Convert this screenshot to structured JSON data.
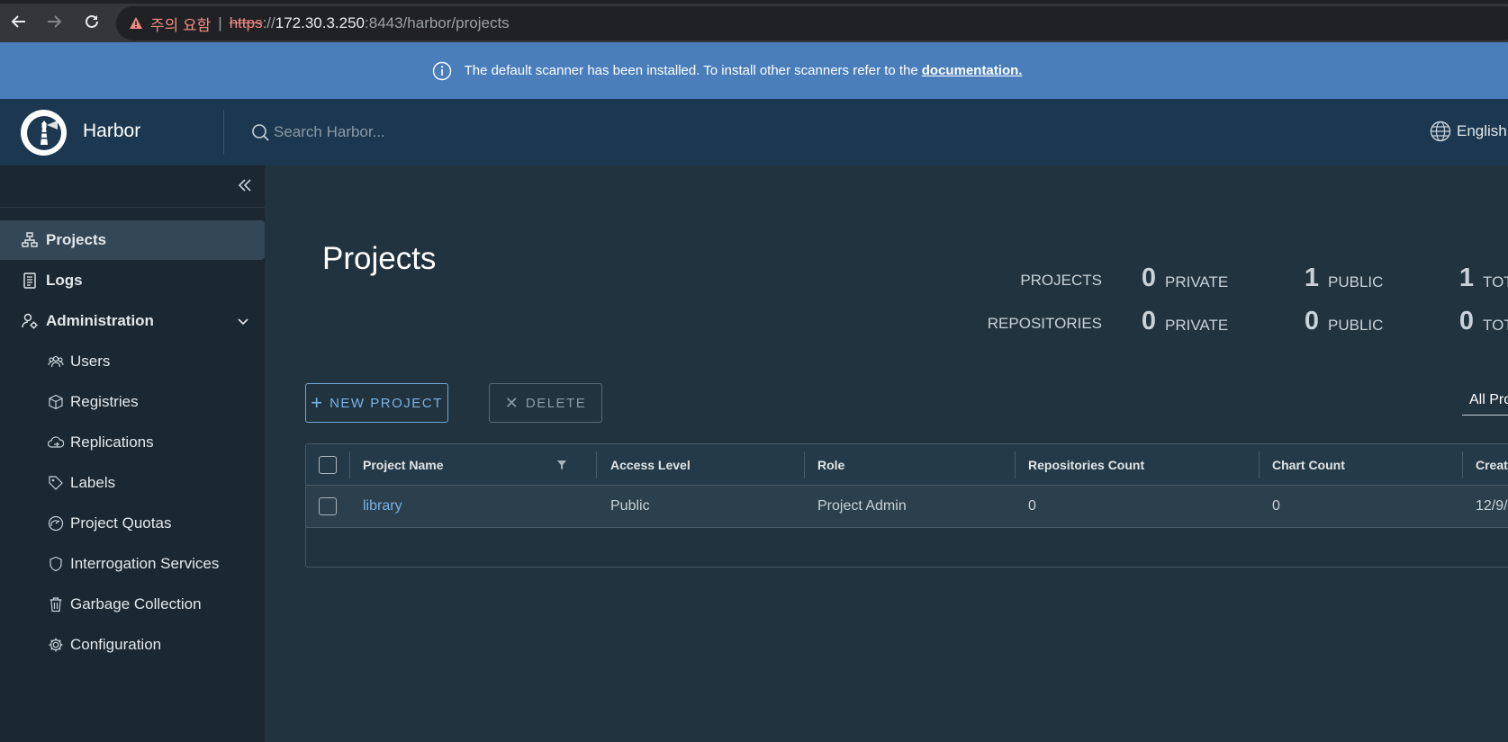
{
  "browser": {
    "warning_text": "주의 요함",
    "url_protocol": "https",
    "url_protocol_rest": "://",
    "url_host": "172.30.3.250",
    "url_path": ":8443/harbor/projects"
  },
  "banner": {
    "text": "The default scanner has been installed. To install other scanners refer to the",
    "link": "documentation."
  },
  "header": {
    "brand": "Harbor",
    "search_placeholder": "Search Harbor...",
    "language": "English"
  },
  "sidebar": {
    "items": [
      {
        "label": "Projects"
      },
      {
        "label": "Logs"
      },
      {
        "label": "Administration"
      }
    ],
    "admin_items": [
      {
        "label": "Users"
      },
      {
        "label": "Registries"
      },
      {
        "label": "Replications"
      },
      {
        "label": "Labels"
      },
      {
        "label": "Project Quotas"
      },
      {
        "label": "Interrogation Services"
      },
      {
        "label": "Garbage Collection"
      },
      {
        "label": "Configuration"
      }
    ]
  },
  "main": {
    "title": "Projects",
    "stats": {
      "projects_label": "PROJECTS",
      "repositories_label": "REPOSITORIES",
      "private_label": "PRIVATE",
      "public_label": "PUBLIC",
      "total_label": "TOTAL",
      "projects_private": "0",
      "projects_public": "1",
      "projects_total": "1",
      "repos_private": "0",
      "repos_public": "0",
      "repos_total": "0"
    },
    "new_project_label": "NEW PROJECT",
    "delete_label": "DELETE",
    "filter_value": "All Projects",
    "table": {
      "columns": [
        "Project Name",
        "Access Level",
        "Role",
        "Repositories Count",
        "Chart Count",
        "Creation Time"
      ],
      "rows": [
        {
          "name": "library",
          "access": "Public",
          "role": "Project Admin",
          "repos": "0",
          "charts": "0",
          "created": "12/9/"
        }
      ]
    }
  }
}
